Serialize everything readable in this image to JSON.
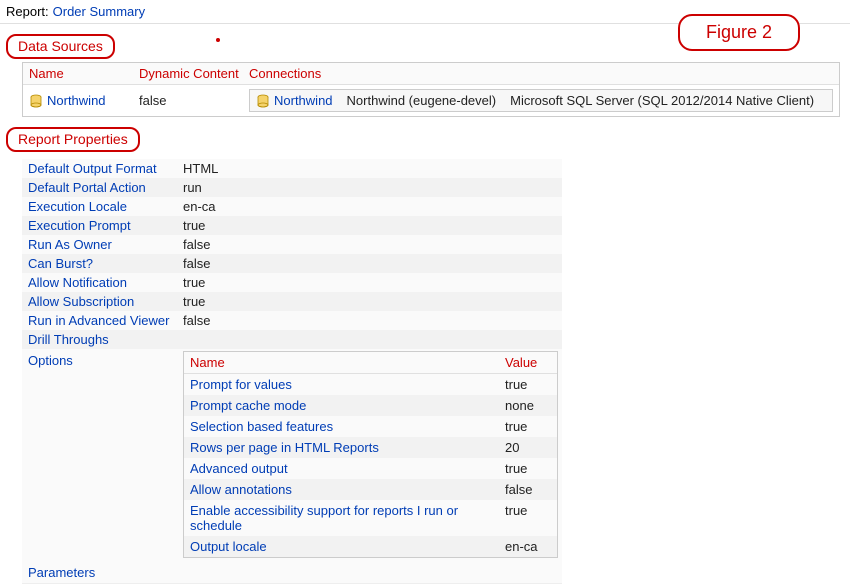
{
  "header": {
    "report_label": "Report:",
    "report_name": "Order Summary",
    "figure": "Figure 2"
  },
  "data_sources": {
    "title": "Data Sources",
    "cols": {
      "name": "Name",
      "dynamic": "Dynamic Content",
      "conn": "Connections"
    },
    "row": {
      "name": "Northwind",
      "dynamic": "false",
      "conn_name": "Northwind",
      "conn_detail": "Northwind (eugene-devel)",
      "conn_driver": "Microsoft SQL Server (SQL 2012/2014 Native Client)"
    }
  },
  "report_props": {
    "title": "Report Properties",
    "rows": [
      {
        "label": "Default Output Format",
        "value": "HTML"
      },
      {
        "label": "Default Portal Action",
        "value": "run"
      },
      {
        "label": "Execution Locale",
        "value": "en-ca"
      },
      {
        "label": "Execution Prompt",
        "value": "true"
      },
      {
        "label": "Run As Owner",
        "value": "false"
      },
      {
        "label": "Can Burst?",
        "value": "false"
      },
      {
        "label": "Allow Notification",
        "value": "true"
      },
      {
        "label": "Allow Subscription",
        "value": "true"
      },
      {
        "label": "Run in Advanced Viewer",
        "value": "false"
      },
      {
        "label": "Drill Throughs",
        "value": ""
      }
    ],
    "options_label": "Options",
    "options_cols": {
      "name": "Name",
      "value": "Value"
    },
    "options": [
      {
        "name": "Prompt for values",
        "value": "true"
      },
      {
        "name": "Prompt cache mode",
        "value": "none"
      },
      {
        "name": "Selection based features",
        "value": "true"
      },
      {
        "name": "Rows per page in HTML Reports",
        "value": "20"
      },
      {
        "name": "Advanced output",
        "value": "true"
      },
      {
        "name": "Allow annotations",
        "value": "false"
      },
      {
        "name": "Enable accessibility support for reports I run or schedule",
        "value": "true"
      },
      {
        "name": "Output locale",
        "value": "en-ca"
      }
    ],
    "parameters_label": "Parameters"
  }
}
